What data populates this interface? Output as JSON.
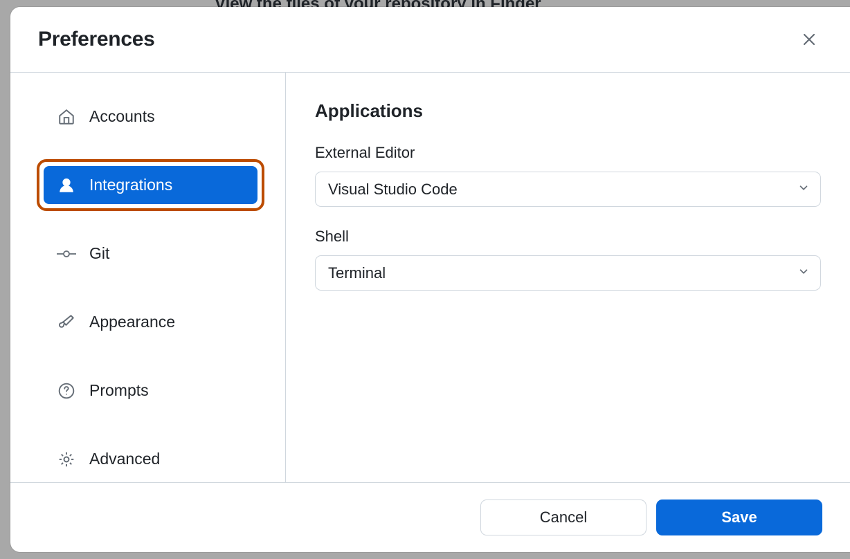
{
  "background": {
    "partial_text": "View the files of your repository in Finder"
  },
  "modal": {
    "title": "Preferences"
  },
  "sidebar": {
    "items": [
      {
        "label": "Accounts"
      },
      {
        "label": "Integrations"
      },
      {
        "label": "Git"
      },
      {
        "label": "Appearance"
      },
      {
        "label": "Prompts"
      },
      {
        "label": "Advanced"
      }
    ]
  },
  "content": {
    "heading": "Applications",
    "external_editor_label": "External Editor",
    "external_editor_value": "Visual Studio Code",
    "shell_label": "Shell",
    "shell_value": "Terminal"
  },
  "footer": {
    "cancel_label": "Cancel",
    "save_label": "Save"
  }
}
